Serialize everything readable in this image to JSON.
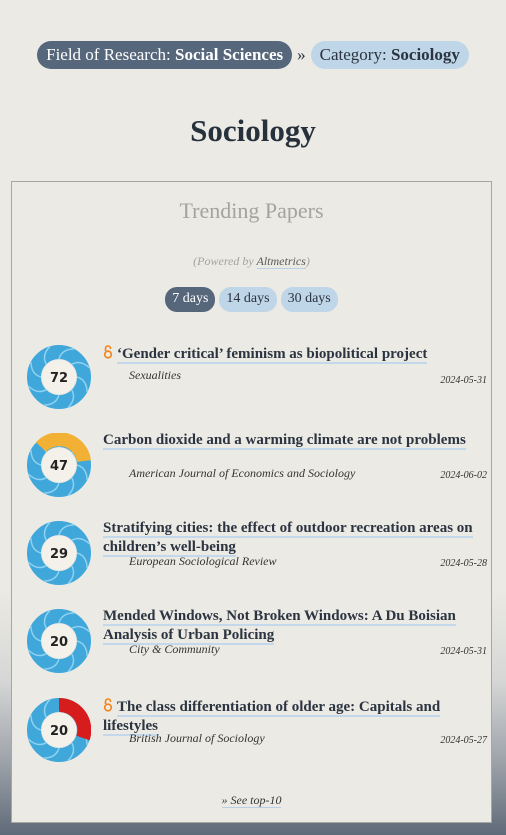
{
  "breadcrumb": {
    "field_prefix": "Field of Research: ",
    "field_value": "Social Sciences",
    "separator": "»",
    "category_prefix": "Category: ",
    "category_value": "Sociology"
  },
  "page_title": "Sociology",
  "trending": {
    "title": "Trending Papers",
    "powered_prefix": "(Powered by ",
    "powered_link": "Altmetrics",
    "powered_suffix": ")",
    "tabs": [
      {
        "label": "7 days",
        "active": true
      },
      {
        "label": "14 days",
        "active": false
      },
      {
        "label": "30 days",
        "active": false
      }
    ],
    "see_top": "» See top-10"
  },
  "papers": [
    {
      "score": "72",
      "open_access": true,
      "title": "‘Gender critical’ feminism as biopolitical project",
      "journal": "Sexualities",
      "date": "2024-05-31",
      "ring_colors": [
        "#3fa7da"
      ]
    },
    {
      "score": "47",
      "open_access": false,
      "title": "Carbon dioxide and a warming climate are not problems",
      "journal": "American Journal of Economics and Sociology",
      "date": "2024-06-02",
      "ring_colors": [
        "#3fa7da",
        "#f2b134"
      ]
    },
    {
      "score": "29",
      "open_access": false,
      "title": "Stratifying cities: the effect of outdoor recreation areas on children’s well-being",
      "journal": "European Sociological Review",
      "date": "2024-05-28",
      "ring_colors": [
        "#3fa7da"
      ]
    },
    {
      "score": "20",
      "open_access": false,
      "title": "Mended Windows, Not Broken Windows: A Du Boisian Analysis of Urban Policing",
      "journal": "City & Community",
      "date": "2024-05-31",
      "ring_colors": [
        "#3fa7da"
      ]
    },
    {
      "score": "20",
      "open_access": true,
      "title": "The class differentiation of older age: Capitals and lifestyles",
      "journal": "British Journal of Sociology",
      "date": "2024-05-27",
      "ring_colors": [
        "#3fa7da",
        "#d61c1c"
      ]
    }
  ]
}
